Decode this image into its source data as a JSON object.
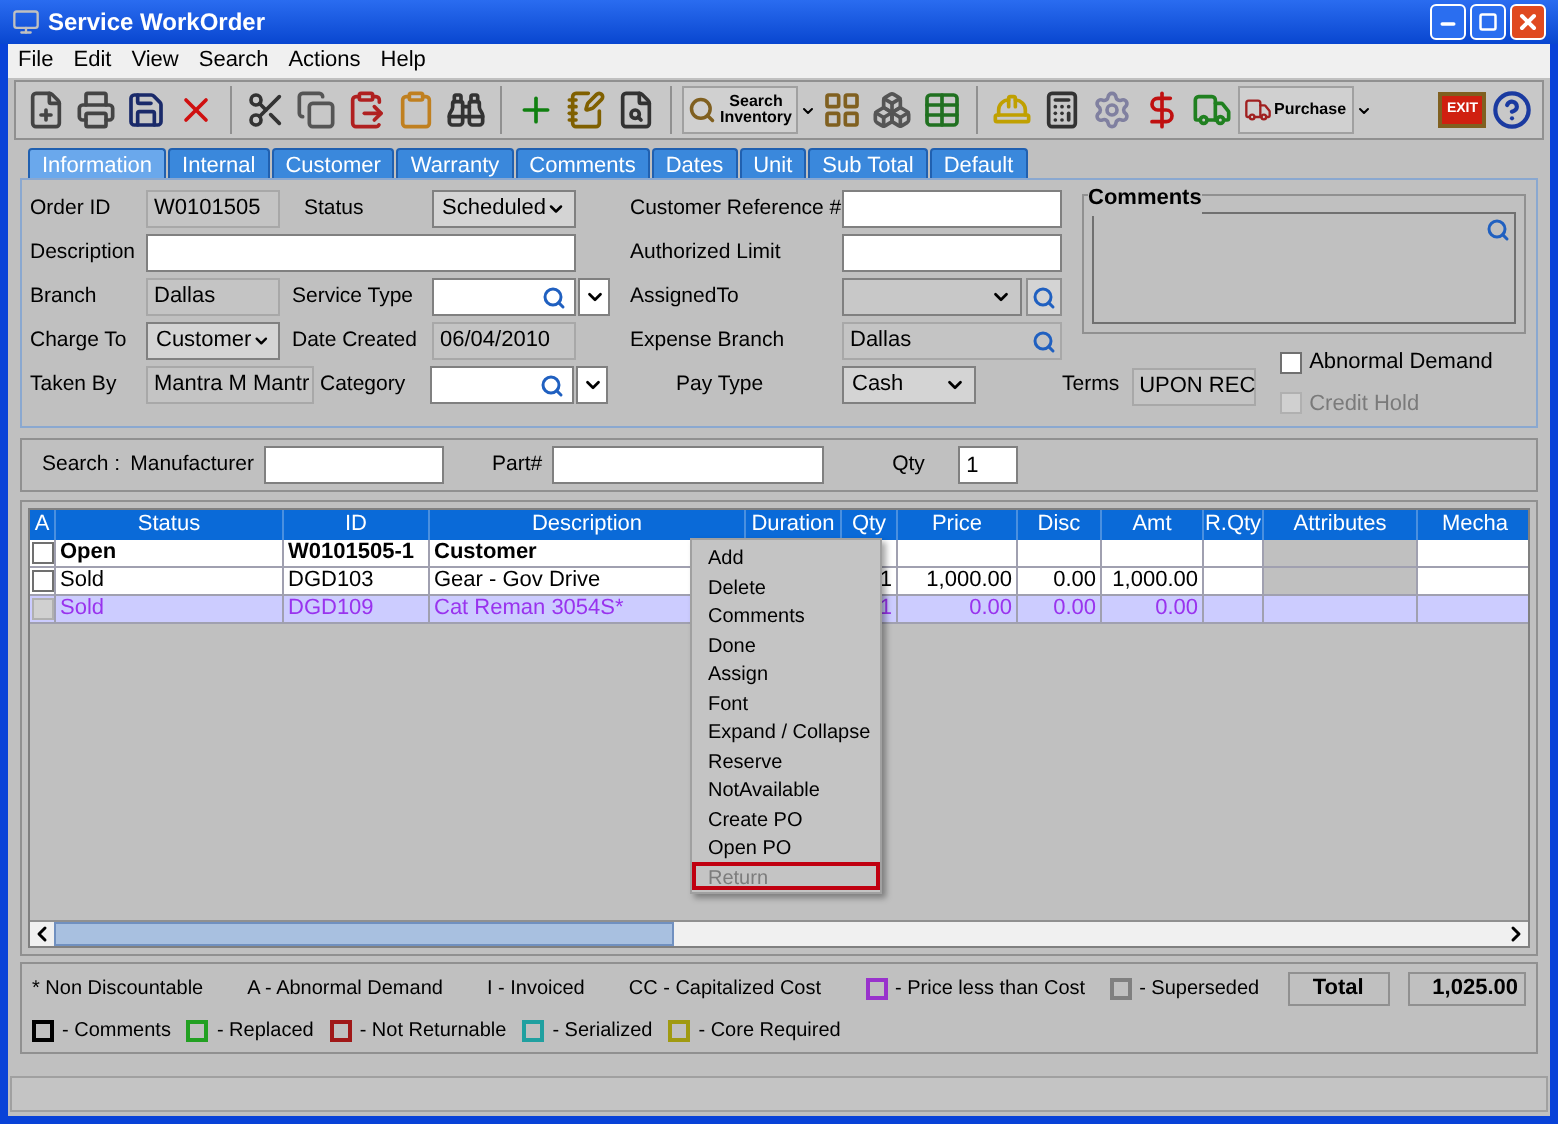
{
  "window": {
    "title": "Service WorkOrder"
  },
  "menu": [
    "File",
    "Edit",
    "View",
    "Search",
    "Actions",
    "Help"
  ],
  "toolbar": {
    "search_inventory": "Search Inventory",
    "purchase": "Purchase",
    "exit": "EXIT"
  },
  "tabs": [
    {
      "label": "Information",
      "selected": true
    },
    {
      "label": "Internal",
      "selected": false
    },
    {
      "label": "Customer",
      "selected": false
    },
    {
      "label": "Warranty",
      "selected": false
    },
    {
      "label": "Comments",
      "selected": false
    },
    {
      "label": "Dates",
      "selected": false
    },
    {
      "label": "Unit",
      "selected": false
    },
    {
      "label": "Sub Total",
      "selected": false
    },
    {
      "label": "Default",
      "selected": false
    }
  ],
  "form": {
    "order_id": {
      "label": "Order ID",
      "value": "W0101505"
    },
    "status": {
      "label": "Status",
      "value": "Scheduled"
    },
    "description": {
      "label": "Description"
    },
    "branch": {
      "label": "Branch",
      "value": "Dallas"
    },
    "service_type": {
      "label": "Service Type"
    },
    "charge_to": {
      "label": "Charge To",
      "value": "Customer"
    },
    "date_created": {
      "label": "Date Created",
      "value": "06/04/2010"
    },
    "taken_by": {
      "label": "Taken By",
      "value": "Mantra M Mantr"
    },
    "category": {
      "label": "Category"
    },
    "customer_reference": {
      "label": "Customer Reference #"
    },
    "authorized_limit": {
      "label": "Authorized Limit"
    },
    "assigned_to": {
      "label": "AssignedTo",
      "disabled": true
    },
    "expense_branch": {
      "label": "Expense Branch",
      "value": "Dallas"
    },
    "pay_type": {
      "label": "Pay Type",
      "value": "Cash"
    },
    "comments": {
      "label": "Comments"
    },
    "terms": {
      "label": "Terms",
      "value": "UPON REC"
    },
    "abnormal_demand": {
      "label": "Abnormal Demand",
      "checked": false,
      "disabled": false
    },
    "credit_hold": {
      "label": "Credit Hold",
      "checked": false,
      "disabled": true
    }
  },
  "search": {
    "label": "Search :",
    "manufacturer": "Manufacturer",
    "part": "Part#",
    "qty": "Qty",
    "qty_value": "1"
  },
  "table": {
    "columns": [
      "A",
      "Status",
      "ID",
      "Description",
      "Duration",
      "Qty",
      "Price",
      "Disc",
      "Amt",
      "R.Qty",
      "Attributes",
      "Mecha"
    ],
    "rows": [
      {
        "checked": false,
        "bold": true,
        "selected": false,
        "cells": [
          null,
          "Open",
          "W0101505-1",
          "Customer",
          null,
          null,
          null,
          null,
          null,
          null,
          null,
          null
        ]
      },
      {
        "checked": false,
        "bold": false,
        "selected": false,
        "cells": [
          null,
          "Sold",
          "DGD103",
          "Gear - Gov Drive",
          null,
          "1",
          "1,000.00",
          "0.00",
          "1,000.00",
          null,
          null,
          null
        ]
      },
      {
        "checked": false,
        "bold": false,
        "selected": true,
        "cells": [
          null,
          "Sold",
          "DGD109",
          "Cat Reman 3054S*",
          null,
          "1",
          "0.00",
          "0.00",
          "0.00",
          null,
          null,
          null
        ]
      }
    ]
  },
  "context_menu": [
    {
      "label": "Add",
      "disabled": false,
      "highlighted": false
    },
    {
      "label": "Delete",
      "disabled": false,
      "highlighted": false
    },
    {
      "label": "Comments",
      "disabled": false,
      "highlighted": false
    },
    {
      "label": "Done",
      "disabled": false,
      "highlighted": false
    },
    {
      "label": "Assign",
      "disabled": false,
      "highlighted": false
    },
    {
      "label": "Font",
      "disabled": false,
      "highlighted": false
    },
    {
      "label": "Expand / Collapse",
      "disabled": false,
      "highlighted": false
    },
    {
      "label": "Reserve",
      "disabled": false,
      "highlighted": false
    },
    {
      "label": "NotAvailable",
      "disabled": false,
      "highlighted": false
    },
    {
      "label": "Create PO",
      "disabled": false,
      "highlighted": false
    },
    {
      "label": "Open PO",
      "disabled": false,
      "highlighted": false
    },
    {
      "label": "Return",
      "disabled": true,
      "highlighted": true
    }
  ],
  "legend": {
    "notes": [
      "* Non Discountable",
      "A - Abnormal Demand",
      "I - Invoiced",
      "CC - Capitalized Cost"
    ],
    "line1": [
      {
        "label": "- Price less than Cost",
        "color": "#9933cc"
      },
      {
        "label": "- Superseded",
        "color": "#808080"
      }
    ],
    "line2": [
      {
        "label": "- Comments",
        "color": "#000000"
      },
      {
        "label": "- Replaced",
        "color": "#22a022"
      },
      {
        "label": "- Not Returnable",
        "color": "#a01818"
      },
      {
        "label": "- Serialized",
        "color": "#20a0a0"
      },
      {
        "label": "- Core Required",
        "color": "#a09a10"
      }
    ],
    "total_label": "Total",
    "total_value": "1,025.00"
  }
}
